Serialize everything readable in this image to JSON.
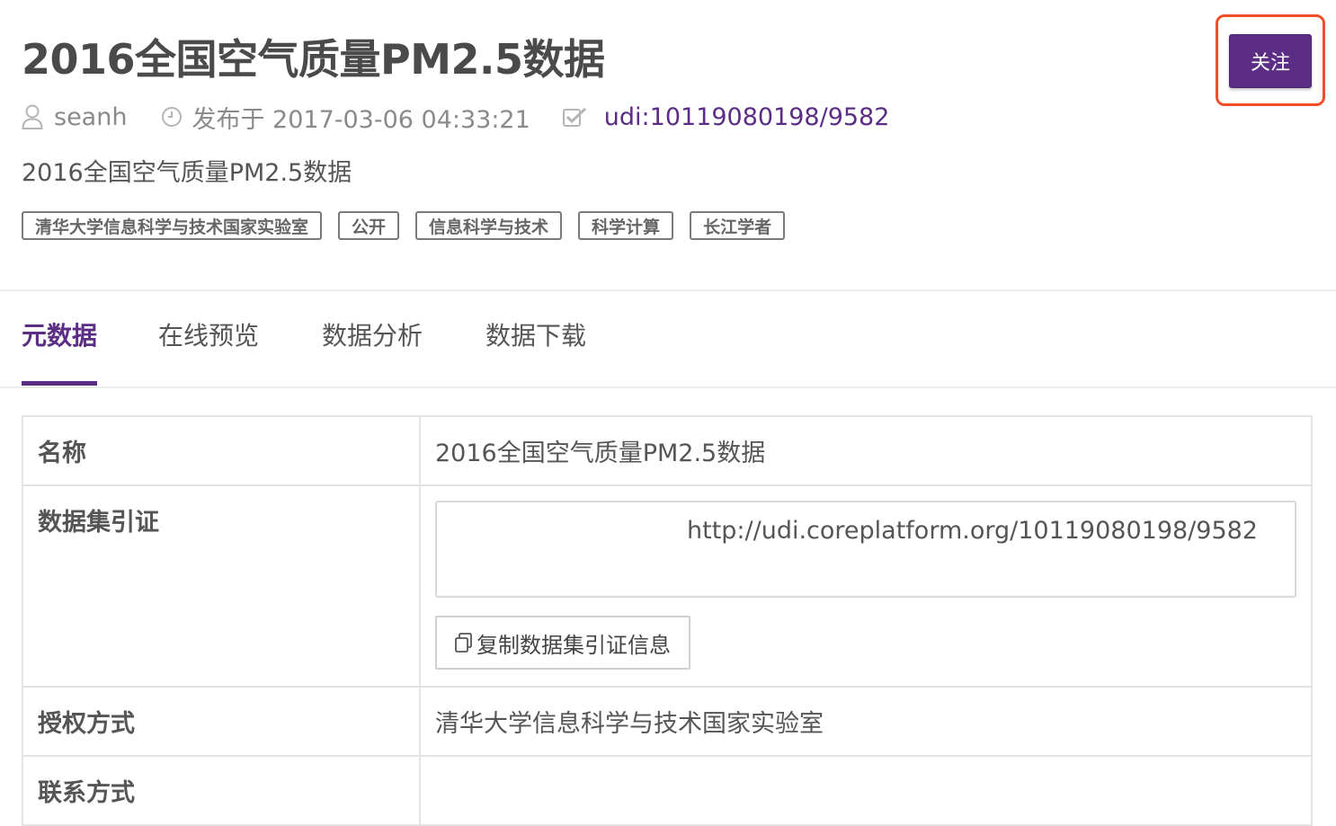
{
  "header": {
    "title": "2016全国空气质量PM2.5数据",
    "follow_label": "关注"
  },
  "meta": {
    "author": "seanh",
    "published": "发布于 2017-03-06 04:33:21",
    "udi": "udi:10119080198/9582",
    "icons": [
      "user-icon",
      "clock-icon",
      "checkbox-icon"
    ]
  },
  "description": "2016全国空气质量PM2.5数据",
  "tags": [
    "清华大学信息科学与技术国家实验室",
    "公开",
    "信息科学与技术",
    "科学计算",
    "长江学者"
  ],
  "tabs": [
    {
      "label": "元数据",
      "active": true
    },
    {
      "label": "在线预览",
      "active": false
    },
    {
      "label": "数据分析",
      "active": false
    },
    {
      "label": "数据下载",
      "active": false
    }
  ],
  "metadata_table": {
    "name_label": "名称",
    "name_value": "2016全国空气质量PM2.5数据",
    "citation_label": "数据集引证",
    "citation_value": "http://udi.coreplatform.org/10119080198/9582",
    "copy_button_label": "复制数据集引证信息",
    "license_label": "授权方式",
    "license_value": "清华大学信息科学与技术国家实验室",
    "contact_label": "联系方式",
    "contact_value": ""
  },
  "colors": {
    "brand": "#5b2d84",
    "highlight": "#f04e2b"
  }
}
